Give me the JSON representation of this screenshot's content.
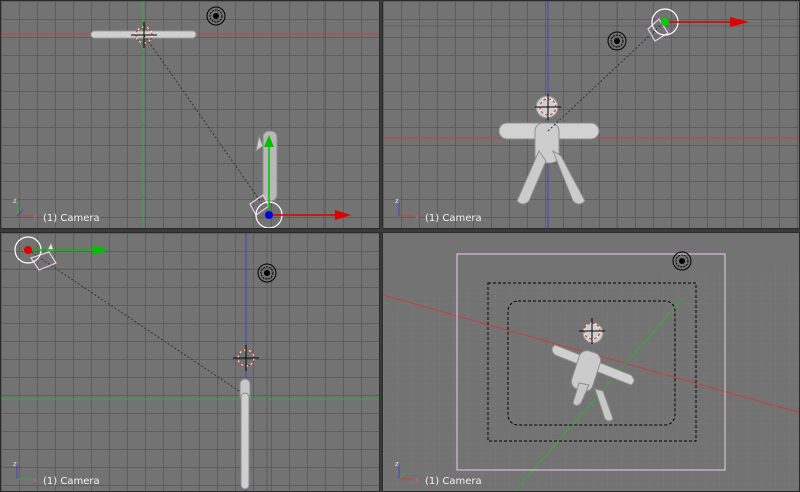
{
  "viewports": [
    {
      "name": "top-left",
      "label": "(1) Camera",
      "axes": {
        "up": "z",
        "side": "x"
      }
    },
    {
      "name": "top-right",
      "label": "(1) Camera",
      "axes": {
        "up": "z",
        "side": "x"
      }
    },
    {
      "name": "bottom-left",
      "label": "(1) Camera",
      "axes": {
        "up": "z",
        "side": "x"
      }
    },
    {
      "name": "bottom-right",
      "label": "(1) Camera",
      "axes": {
        "up": "z",
        "side": "x"
      }
    }
  ],
  "colors": {
    "background": "#737373",
    "grid": "#5a5a5a",
    "x_axis": "#c44040",
    "y_axis": "#3aa83a",
    "z_axis": "#4040c8",
    "manipulator_x": "#e00000",
    "manipulator_y": "#00c000",
    "manipulator_z": "#0000e0",
    "camera_frame": "#f0c8f0",
    "label_text": "#f2f2f2"
  },
  "icons": [
    "lamp-icon",
    "camera-icon",
    "cursor-icon",
    "axis-icon",
    "transform-manipulator-icon"
  ]
}
